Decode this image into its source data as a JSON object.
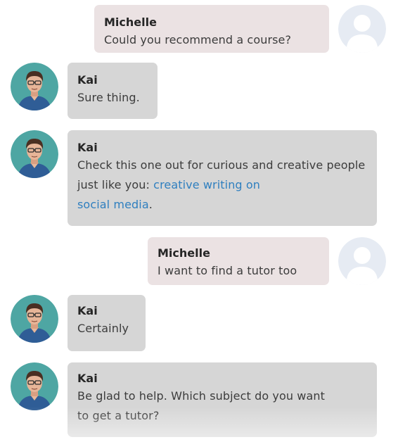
{
  "messages": [
    {
      "sender": "Michelle",
      "text": "Could you recommend a course?"
    },
    {
      "sender": "Kai",
      "text": "Sure thing."
    },
    {
      "sender": "Kai",
      "text_before": "Check this one out for curious and creative people just like you: ",
      "link_line1": "creative writing on",
      "link_line2": "social media",
      "text_after": "."
    },
    {
      "sender": "Michelle",
      "text": "I want to find a tutor too"
    },
    {
      "sender": "Kai",
      "text": "Certainly"
    },
    {
      "sender": "Kai",
      "text_line1": "Be glad to help. Which subject do you want",
      "text_line2": "to get a tutor?"
    }
  ],
  "avatars": {
    "bot": "man-with-glasses-avatar",
    "user": "default-user-avatar"
  },
  "colors": {
    "bot_bubble": "#d6d6d6",
    "user_bubble": "#ebe2e3",
    "link": "#2f7fbf"
  }
}
